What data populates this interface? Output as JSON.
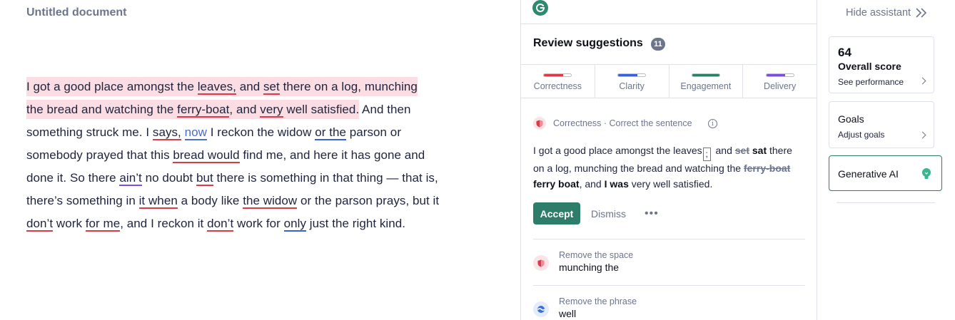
{
  "document": {
    "title": "Untitled document",
    "hl_1": "I got a good place amongst the ",
    "hl_leaves": "leaves,",
    "hl_2": " and ",
    "hl_set": "set",
    "hl_3": " there on a log, munching",
    "hl_4": "the bread and watching the ",
    "hl_ferry": "ferry-boat",
    "hl_5": ", and ",
    "hl_very": "very",
    "hl_6": " well satisfied.",
    "t_1": " And then something struck me. I ",
    "t_says": "says,",
    "t_2": " ",
    "t_now": "now",
    "t_3": " I reckon the widow ",
    "t_orthe": "or the",
    "t_4": " parson or somebody prayed that this ",
    "t_bread": "bread  would",
    "t_5": " find me, and here it has gone and done it. So there ",
    "t_aint": "ain’t",
    "t_6": " no doubt ",
    "t_but": "but",
    "t_7": " there is something in that thing — that is, there’s something in ",
    "t_itwhen": "it  when",
    "t_8": " a body like ",
    "t_widow": "the widow",
    "t_9": " or the parson prays, but it ",
    "t_dont1": "don’t",
    "t_10": " work ",
    "t_forme": "for  me",
    "t_11": ", and I reckon it ",
    "t_dont2": "don’t",
    "t_12": " work for ",
    "t_only": "only",
    "t_13": " just the right kind."
  },
  "review": {
    "title": "Review suggestions",
    "count": "11",
    "tabs": [
      {
        "label": "Correctness",
        "color": "#d93b48",
        "fill": 0.7
      },
      {
        "label": "Clarity",
        "color": "#3b5fd9",
        "fill": 0.7
      },
      {
        "label": "Engagement",
        "color": "#2d7d6a",
        "fill": 1.0
      },
      {
        "label": "Delivery",
        "color": "#7c4fd6",
        "fill": 0.7
      }
    ],
    "card": {
      "category": "Correctness · Correct the sentence",
      "text_1": "I got a good place amongst the leaves",
      "caret": ";",
      "text_2": " and ",
      "del_1": "set",
      "text_3": " ",
      "ins_1": "sat",
      "text_4": " there on a log, munching the bread and watching the ",
      "del_2": "ferry-boat",
      "text_5": " ",
      "ins_2": "ferry boat",
      "text_6": ", and ",
      "ins_3": "I was",
      "text_7": " very well satisfied.",
      "accept": "Accept",
      "dismiss": "Dismiss",
      "more": "•••"
    },
    "suggestions": [
      {
        "type": "Remove the space",
        "text": "munching the",
        "icon": "shield-icon"
      },
      {
        "type": "Remove the phrase",
        "text": "well",
        "icon": "clarity-icon"
      }
    ]
  },
  "sidebar": {
    "hide": "Hide assistant",
    "score": "64",
    "score_label": "Overall score",
    "score_sub": "See performance",
    "goals_label": "Goals",
    "goals_sub": "Adjust goals",
    "gen_ai": "Generative AI"
  }
}
